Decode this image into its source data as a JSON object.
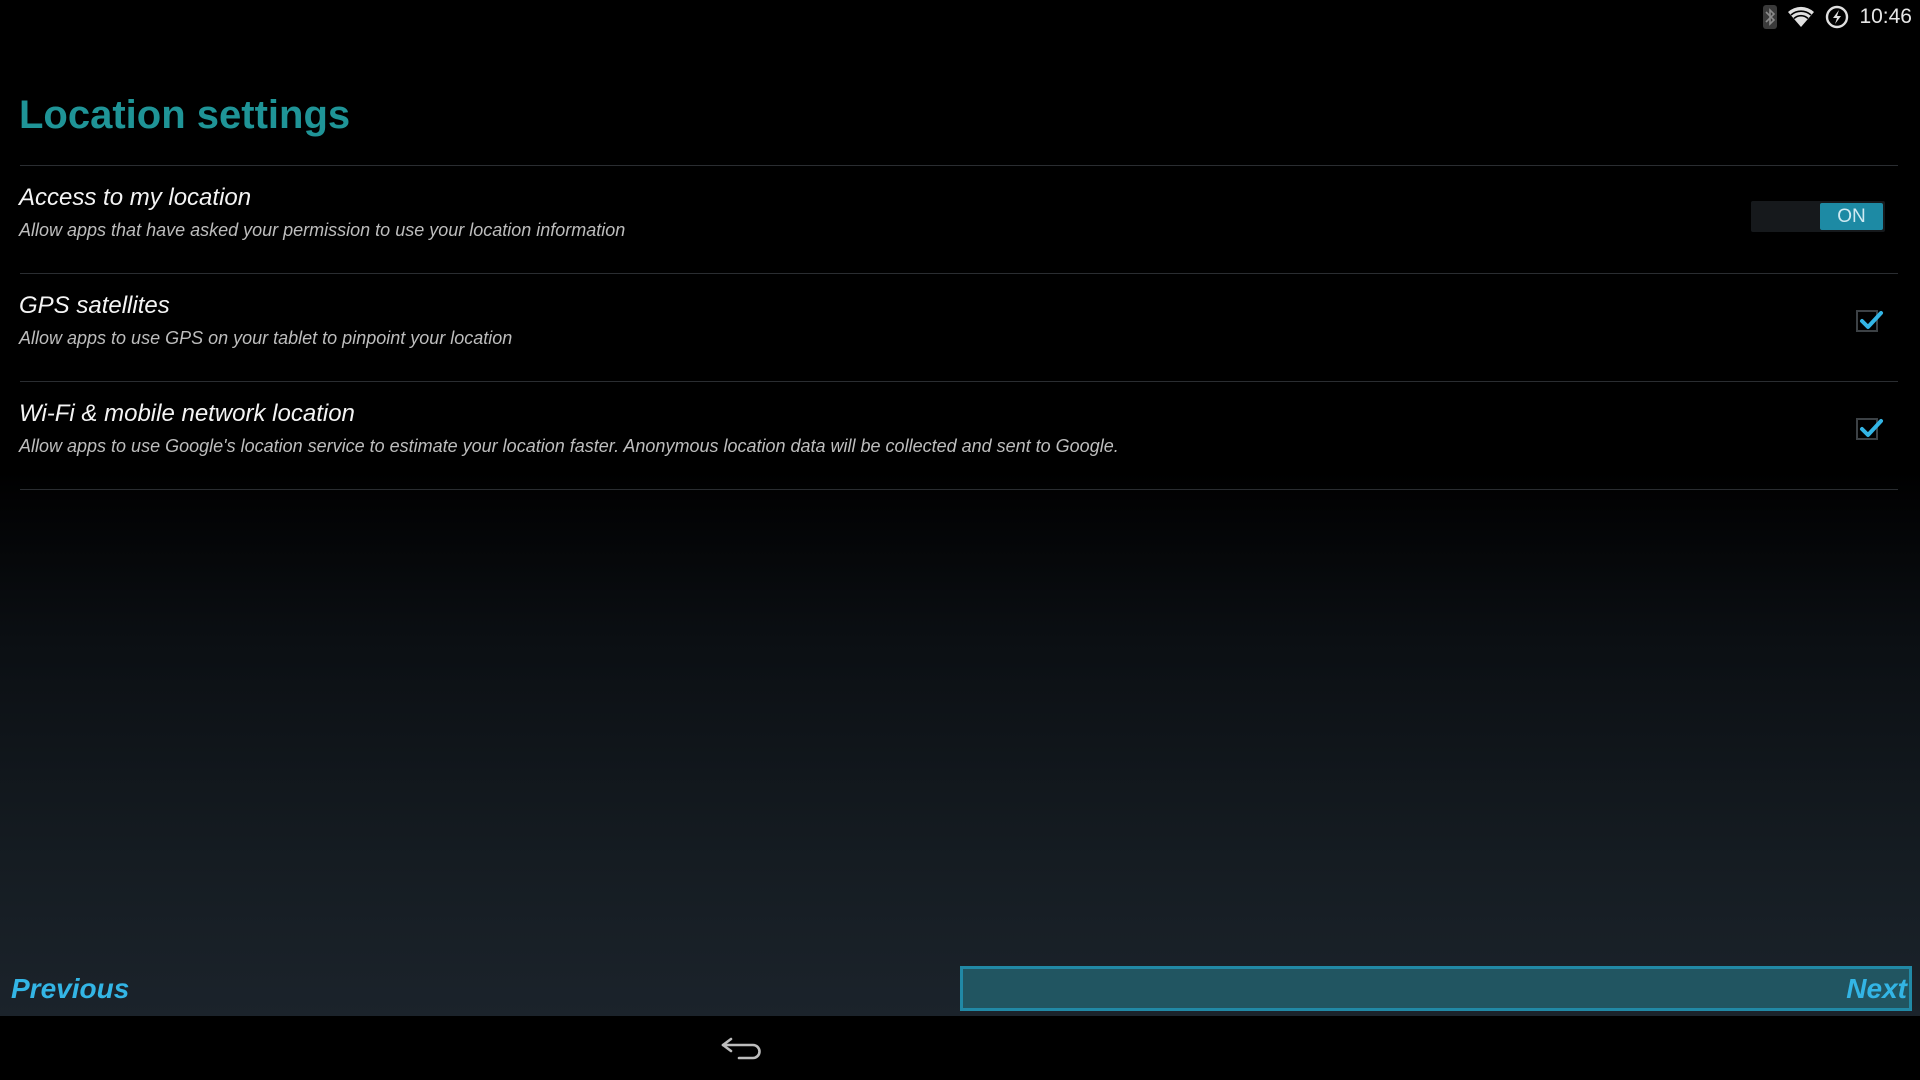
{
  "status_bar": {
    "icons": [
      "bluetooth-icon",
      "wifi-icon",
      "power-saver-icon"
    ],
    "time": "10:46"
  },
  "page": {
    "title": "Location settings"
  },
  "preferences": [
    {
      "title": "Access to my location",
      "summary": "Allow apps that have asked your permission to use your location information",
      "control": "switch",
      "state": "ON"
    },
    {
      "title": "GPS satellites",
      "summary": "Allow apps to use GPS on your tablet to pinpoint your location",
      "control": "checkbox",
      "checked": true
    },
    {
      "title": "Wi-Fi & mobile network location",
      "summary": "Allow apps to use Google's location service to estimate your location faster. Anonymous location data will be collected and sent to Google.",
      "control": "checkbox",
      "checked": true
    }
  ],
  "footer": {
    "previous_label": "Previous",
    "next_label": "Next"
  },
  "nav_bar": {
    "back_icon": "back-icon"
  },
  "colors": {
    "title_teal": "#1f9497",
    "accent_blue": "#33b5e5",
    "switch_on": "#1d8aa4",
    "next_button_bg": "#215561",
    "next_button_border": "#2189a6"
  }
}
